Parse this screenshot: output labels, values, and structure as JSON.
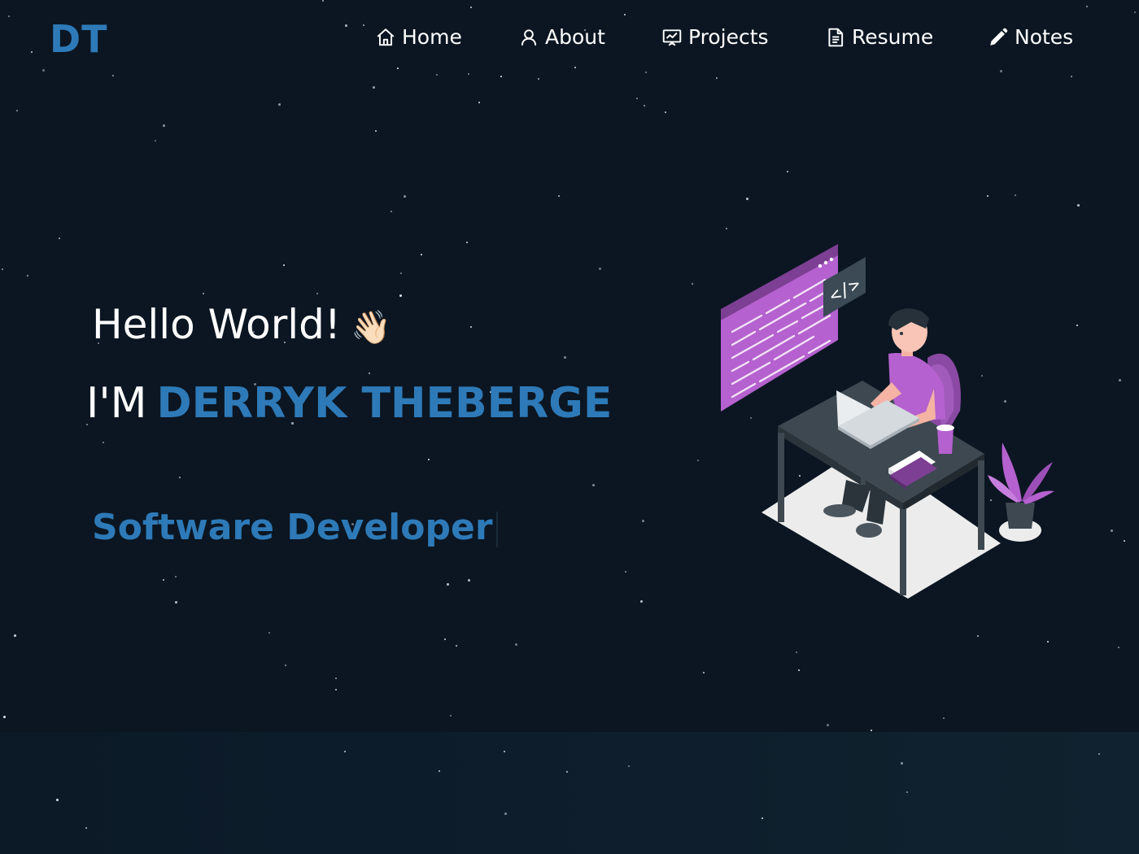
{
  "logo": "DT",
  "nav": {
    "home": "Home",
    "about": "About",
    "projects": "Projects",
    "resume": "Resume",
    "notes": "Notes"
  },
  "hero": {
    "greeting": "Hello World!",
    "wave": "👋🏻",
    "intro_prefix": "I'M",
    "name": "DERRYK THEBERGE",
    "role": "Software Developer"
  },
  "illustration": {
    "code_badge": "</>"
  },
  "colors": {
    "background": "#0b1622",
    "accent": "#2e7ab8",
    "purple": "#b561cf"
  },
  "icons": [
    "home-icon",
    "user-icon",
    "presentation-icon",
    "document-icon",
    "pencil-icon"
  ]
}
